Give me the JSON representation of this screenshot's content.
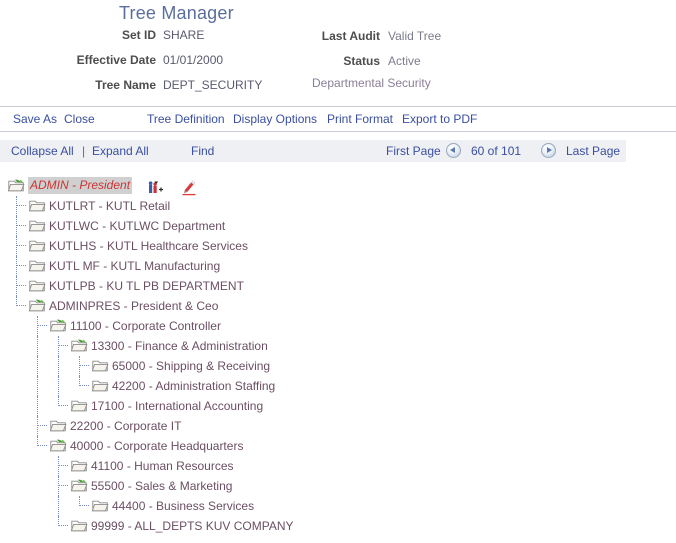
{
  "header": {
    "title": "Tree Manager",
    "fields_left": [
      {
        "label": "Set ID",
        "value": "SHARE"
      },
      {
        "label": "Effective Date",
        "value": "01/01/2000"
      },
      {
        "label": "Tree Name",
        "value": "DEPT_SECURITY"
      }
    ],
    "fields_right": [
      {
        "label": "Last Audit",
        "value": "Valid Tree"
      },
      {
        "label": "Status",
        "value": "Active"
      }
    ],
    "description": "Departmental Security"
  },
  "action_bar": {
    "save_as": "Save As",
    "close": "Close",
    "tree_definition": "Tree Definition",
    "display_options": "Display Options",
    "print_format": "Print Format",
    "export_to_pdf": "Export to PDF"
  },
  "nav_bar": {
    "collapse_all": "Collapse All",
    "separator": "|",
    "expand_all": "Expand All",
    "find": "Find",
    "first_page": "First Page",
    "page_count": "60 of 101",
    "last_page": "Last Page",
    "prev_icon": "prev-page-arrow-icon",
    "next_icon": "next-page-arrow-icon"
  },
  "tree": {
    "root_actions": [
      {
        "name": "add-sibling-node-icon"
      },
      {
        "name": "edit-node-icon"
      }
    ],
    "nodes": [
      {
        "level": 0,
        "icon": "folder-open-icon",
        "label": "ADMIN - President",
        "selected": true
      },
      {
        "level": 1,
        "icon": "folder-closed-icon",
        "label": "KUTLRT - KUTL Retail",
        "selected": false
      },
      {
        "level": 1,
        "icon": "folder-closed-icon",
        "label": "KUTLWC - KUTLWC Department",
        "selected": false
      },
      {
        "level": 1,
        "icon": "folder-closed-icon",
        "label": "KUTLHS - KUTL Healthcare Services",
        "selected": false
      },
      {
        "level": 1,
        "icon": "folder-closed-icon",
        "label": "KUTL MF - KUTL Manufacturing",
        "selected": false
      },
      {
        "level": 1,
        "icon": "folder-closed-icon",
        "label": "KUTLPB - KU TL PB DEPARTMENT",
        "selected": false
      },
      {
        "level": 1,
        "icon": "folder-open-icon",
        "label": "ADMINPRES - President & Ceo",
        "selected": false
      },
      {
        "level": 2,
        "icon": "folder-open-icon",
        "label": "11100 - Corporate Controller",
        "selected": false
      },
      {
        "level": 3,
        "icon": "folder-open-icon",
        "label": "13300 - Finance & Administration",
        "selected": false
      },
      {
        "level": 4,
        "icon": "folder-closed-icon",
        "label": "65000 - Shipping & Receiving",
        "selected": false
      },
      {
        "level": 4,
        "icon": "folder-closed-icon",
        "label": "42200 - Administration Staffing",
        "selected": false
      },
      {
        "level": 3,
        "icon": "folder-closed-icon",
        "label": "17100 - International Accounting",
        "selected": false
      },
      {
        "level": 2,
        "icon": "folder-closed-icon",
        "label": "22200 - Corporate IT",
        "selected": false
      },
      {
        "level": 2,
        "icon": "folder-open-icon",
        "label": "40000 - Corporate Headquarters",
        "selected": false
      },
      {
        "level": 3,
        "icon": "folder-closed-icon",
        "label": "41100 - Human Resources",
        "selected": false
      },
      {
        "level": 3,
        "icon": "folder-open-icon",
        "label": "55500 - Sales & Marketing",
        "selected": false
      },
      {
        "level": 4,
        "icon": "folder-closed-icon",
        "label": "44400 - Business Services",
        "selected": false
      },
      {
        "level": 3,
        "icon": "folder-closed-icon",
        "label": "99999 - ALL_DEPTS KUV COMPANY",
        "selected": false
      }
    ]
  },
  "colors": {
    "title": "#5b6f9c",
    "link": "#3a4fa0",
    "node_label": "#6b4f63",
    "selected_node": "#cc3333",
    "nav_bar_bg": "#eef0f3",
    "description": "#8a7e96"
  }
}
